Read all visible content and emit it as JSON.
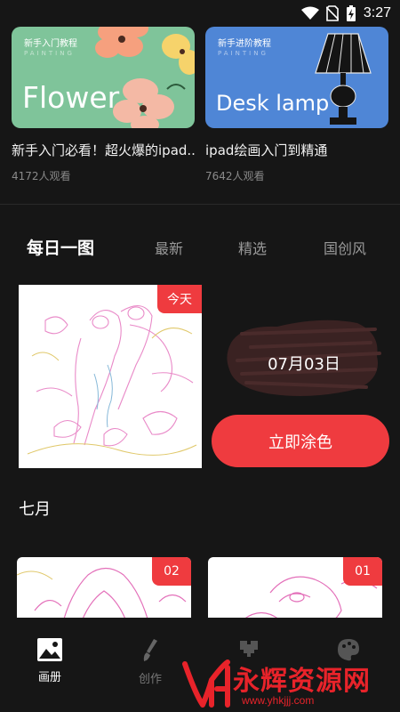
{
  "status_bar": {
    "time": "3:27",
    "icons": [
      "wifi-icon",
      "no-sim-icon",
      "battery-charging-icon"
    ]
  },
  "courses": [
    {
      "tag": "新手入门教程",
      "sub": "PAINTING",
      "headline": "Flower",
      "title": "新手入门必看！超火爆的ipad...",
      "views": "4172人观看"
    },
    {
      "tag": "新手进阶教程",
      "sub": "PAINTING",
      "headline": "Desk lamp",
      "title": "ipad绘画入门到精通",
      "views": "7642人观看"
    }
  ],
  "tabs": [
    {
      "label": "每日一图",
      "active": true
    },
    {
      "label": "最新",
      "active": false
    },
    {
      "label": "精选",
      "active": false
    },
    {
      "label": "国创风",
      "active": false
    }
  ],
  "daily": {
    "badge": "今天",
    "date": "07月03日",
    "button": "立即涂色"
  },
  "month": {
    "label": "七月",
    "items": [
      {
        "badge": "02"
      },
      {
        "badge": "01"
      }
    ]
  },
  "bottom_nav": [
    {
      "label": "画册",
      "icon": "image-icon",
      "active": true
    },
    {
      "label": "创作",
      "icon": "brush-icon",
      "active": false
    },
    {
      "label": "",
      "icon": "pixel-heart-icon",
      "active": false
    },
    {
      "label": "",
      "icon": "palette-icon",
      "active": false
    }
  ],
  "watermark": {
    "text": "永辉资源网",
    "url": "www.yhkjjj.com"
  },
  "colors": {
    "accent": "#ef3b3f",
    "background": "#161616",
    "flower_card": "#7fc49a",
    "lamp_card": "#4f86d6"
  }
}
